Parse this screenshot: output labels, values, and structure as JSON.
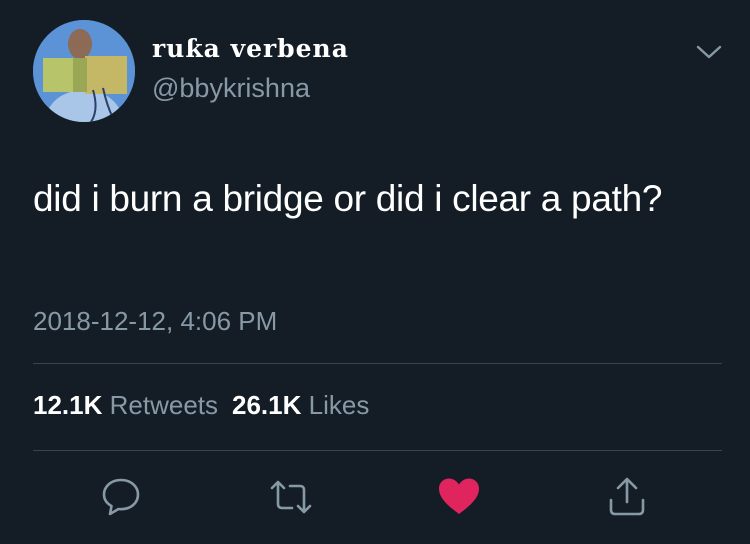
{
  "tweet": {
    "display_name": "ruƙa verbena",
    "handle": "@bbykrishna",
    "text": "did i burn a bridge or did i clear a path?",
    "timestamp": "2018-12-12, 4:06 PM"
  },
  "stats": {
    "retweets_count": "12.1K",
    "retweets_label": "Retweets",
    "likes_count": "26.1K",
    "likes_label": "Likes"
  },
  "actions": {
    "reply_icon": "speech-bubble-icon",
    "retweet_icon": "retweet-arrows-icon",
    "like_icon": "heart-icon",
    "share_icon": "share-upload-icon",
    "liked": true
  },
  "colors": {
    "background": "#141d26",
    "text": "#ffffff",
    "secondary": "#8899a6",
    "divider": "#38444d",
    "like": "#e0245e",
    "icon": "#8899a6"
  }
}
